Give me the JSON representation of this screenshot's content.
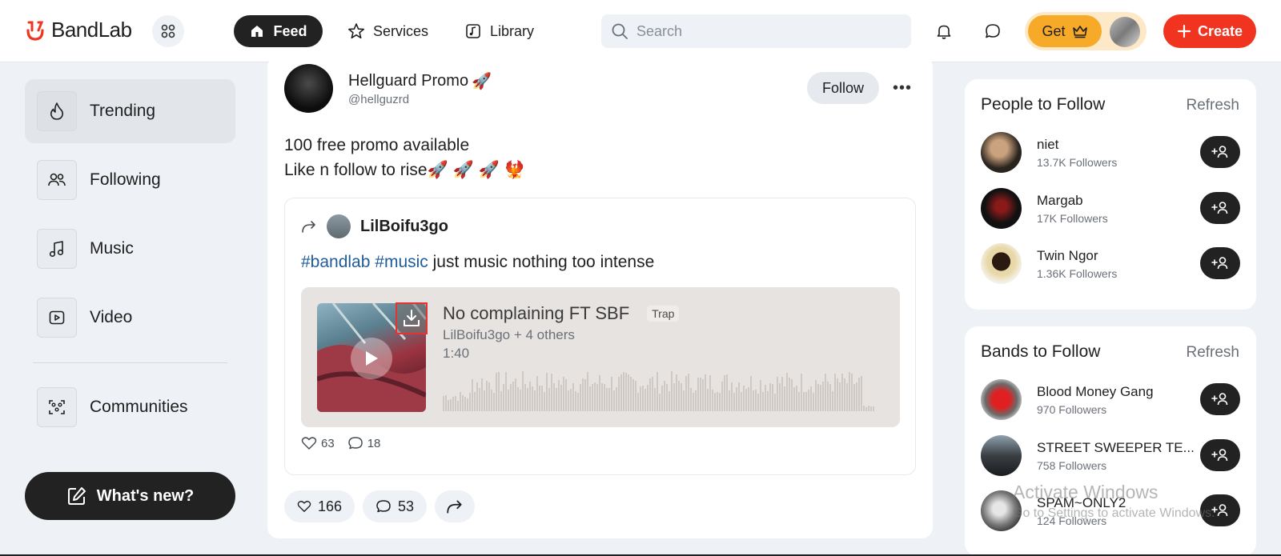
{
  "app": {
    "name": "BandLab"
  },
  "nav": {
    "feed": "Feed",
    "services": "Services",
    "library": "Library",
    "search_placeholder": "Search",
    "get": "Get",
    "create": "Create"
  },
  "sidebar": {
    "items": [
      {
        "label": "Trending",
        "icon": "flame-icon"
      },
      {
        "label": "Following",
        "icon": "people-icon"
      },
      {
        "label": "Music",
        "icon": "music-note-icon"
      },
      {
        "label": "Video",
        "icon": "video-icon"
      },
      {
        "label": "Communities",
        "icon": "communities-icon"
      }
    ],
    "whats_new": "What's new?"
  },
  "post": {
    "author": "Hellguard Promo",
    "author_emoji": "🚀",
    "handle": "@hellguzrd",
    "follow": "Follow",
    "text_line1": "100 free promo available",
    "text_line2": "Like n follow to rise🚀 🚀 🚀 🐦‍🔥",
    "likes": "166",
    "comments": "53",
    "repost": {
      "author": "LilBoifu3go",
      "hashtag1": "#bandlab",
      "hashtag2": "#music",
      "text": " just music nothing too intense",
      "track": {
        "title": "No complaining FT SBF",
        "genre": "Trap",
        "artists": "LilBoifu3go + 4 others",
        "duration": "1:40"
      },
      "likes": "63",
      "comments": "18"
    }
  },
  "people_to_follow": {
    "title": "People to Follow",
    "refresh": "Refresh",
    "people": [
      {
        "name": "niet",
        "followers": "13.7K Followers"
      },
      {
        "name": "Margab",
        "followers": "17K Followers"
      },
      {
        "name": "Twin Ngor",
        "followers": "1.36K Followers"
      }
    ]
  },
  "bands_to_follow": {
    "title": "Bands to Follow",
    "refresh": "Refresh",
    "bands": [
      {
        "name": "Blood Money Gang",
        "followers": "970 Followers"
      },
      {
        "name": "STREET SWEEPER TE...",
        "followers": "758 Followers"
      },
      {
        "name": "SPAM~ONLY2",
        "followers": "124 Followers"
      }
    ]
  },
  "watermark": {
    "line1": "Activate Windows",
    "line2": "Go to Settings to activate Windows."
  },
  "colors": {
    "brand": "#f1341f",
    "dark": "#222222",
    "gold": "#f7a928",
    "hashtag": "#1f5c99",
    "download_highlight": "#e53232"
  }
}
